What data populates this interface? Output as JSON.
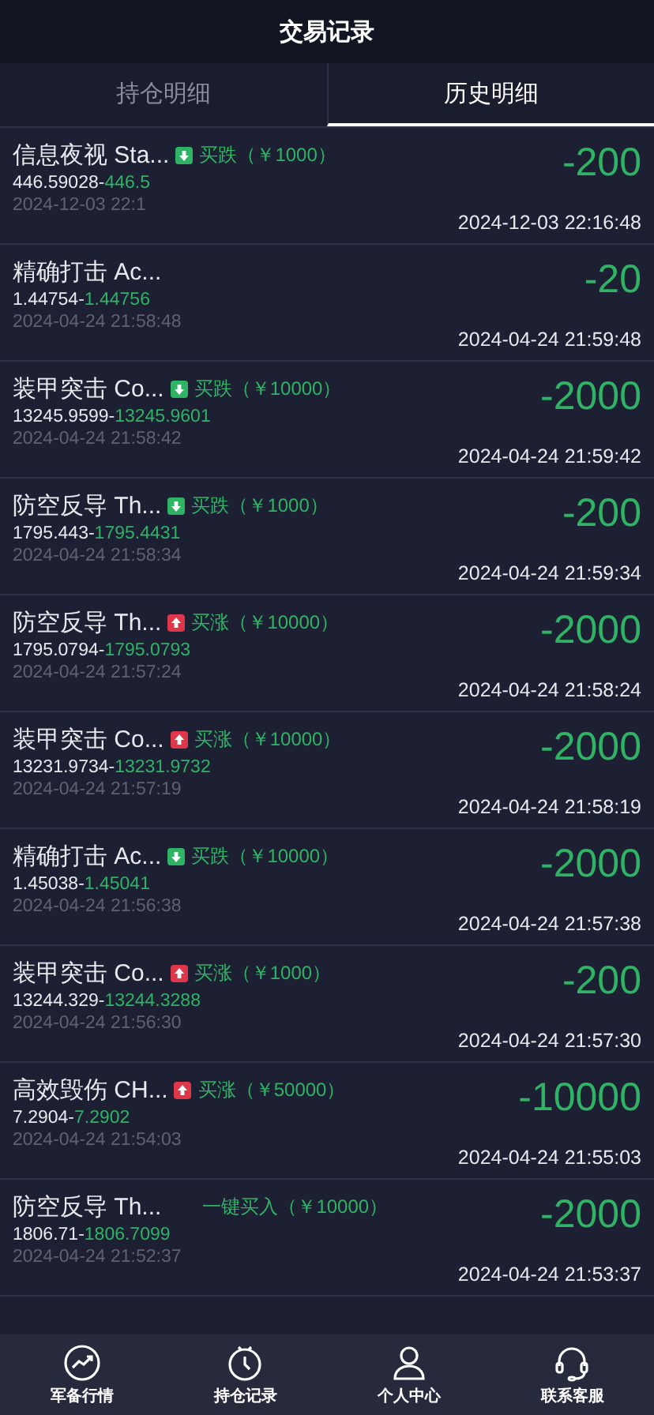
{
  "header": {
    "title": "交易记录"
  },
  "tabs": [
    {
      "label": "持仓明细",
      "selected": false
    },
    {
      "label": "历史明细",
      "selected": true
    }
  ],
  "records": [
    {
      "name": "信息夜视 Sta...",
      "kind": "down",
      "tag": "买跌",
      "amount": "（￥1000）",
      "open_price": "446.59028-",
      "close_price": "446.5",
      "open_time": "2024-12-03 22:1",
      "profit": "-200",
      "close_time": "2024-12-03 22:16:48"
    },
    {
      "name": "精确打击 Ac...",
      "open_price": "1.44754-",
      "close_price": "1.44756",
      "open_time": "2024-04-24 21:58:48",
      "profit": "-20",
      "close_time": "2024-04-24 21:59:48"
    },
    {
      "name": "装甲突击 Co...",
      "kind": "down",
      "tag": "买跌",
      "amount": "（￥10000）",
      "open_price": "13245.9599-",
      "close_price": "13245.9601",
      "open_time": "2024-04-24 21:58:42",
      "profit": "-2000",
      "close_time": "2024-04-24 21:59:42"
    },
    {
      "name": "防空反导 Th...",
      "kind": "down",
      "tag": "买跌",
      "amount": "（￥1000）",
      "open_price": "1795.443-",
      "close_price": "1795.4431",
      "open_time": "2024-04-24 21:58:34",
      "profit": "-200",
      "close_time": "2024-04-24 21:59:34"
    },
    {
      "name": "防空反导 Th...",
      "kind": "up",
      "tag": "买涨",
      "amount": "（￥10000）",
      "open_price": "1795.0794-",
      "close_price": "1795.0793",
      "open_time": "2024-04-24 21:57:24",
      "profit": "-2000",
      "close_time": "2024-04-24 21:58:24"
    },
    {
      "name": "装甲突击 Co...",
      "kind": "up",
      "tag": "买涨",
      "amount": "（￥10000）",
      "open_price": "13231.9734-",
      "close_price": "13231.9732",
      "open_time": "2024-04-24 21:57:19",
      "profit": "-2000",
      "close_time": "2024-04-24 21:58:19"
    },
    {
      "name": "精确打击 Ac...",
      "kind": "down",
      "tag": "买跌",
      "amount": "（￥10000）",
      "open_price": "1.45038-",
      "close_price": "1.45041",
      "open_time": "2024-04-24 21:56:38",
      "profit": "-2000",
      "close_time": "2024-04-24 21:57:38"
    },
    {
      "name": "装甲突击 Co...",
      "kind": "up",
      "tag": "买涨",
      "amount": "（￥1000）",
      "open_price": "13244.329-",
      "close_price": "13244.3288",
      "open_time": "2024-04-24 21:56:30",
      "profit": "-200",
      "close_time": "2024-04-24 21:57:30"
    },
    {
      "name": "高效毁伤 CH...",
      "kind": "up",
      "tag": "买涨",
      "amount": "（￥50000）",
      "open_price": "7.2904-",
      "close_price": "7.2902",
      "open_time": "2024-04-24 21:54:03",
      "profit": "-10000",
      "close_time": "2024-04-24 21:55:03"
    },
    {
      "name": "防空反导 Th...",
      "kind": "quick",
      "tag": "一键买入",
      "amount": "（￥10000）",
      "open_price": "1806.71-",
      "close_price": "1806.7099",
      "open_time": "2024-04-24 21:52:37",
      "profit": "-2000",
      "close_time": "2024-04-24 21:53:37"
    }
  ],
  "nav": [
    {
      "kind": "chart",
      "label": "军备行情"
    },
    {
      "kind": "clock",
      "label": "持仓记录"
    },
    {
      "kind": "person",
      "label": "个人中心"
    },
    {
      "kind": "headset",
      "label": "联系客服"
    }
  ]
}
